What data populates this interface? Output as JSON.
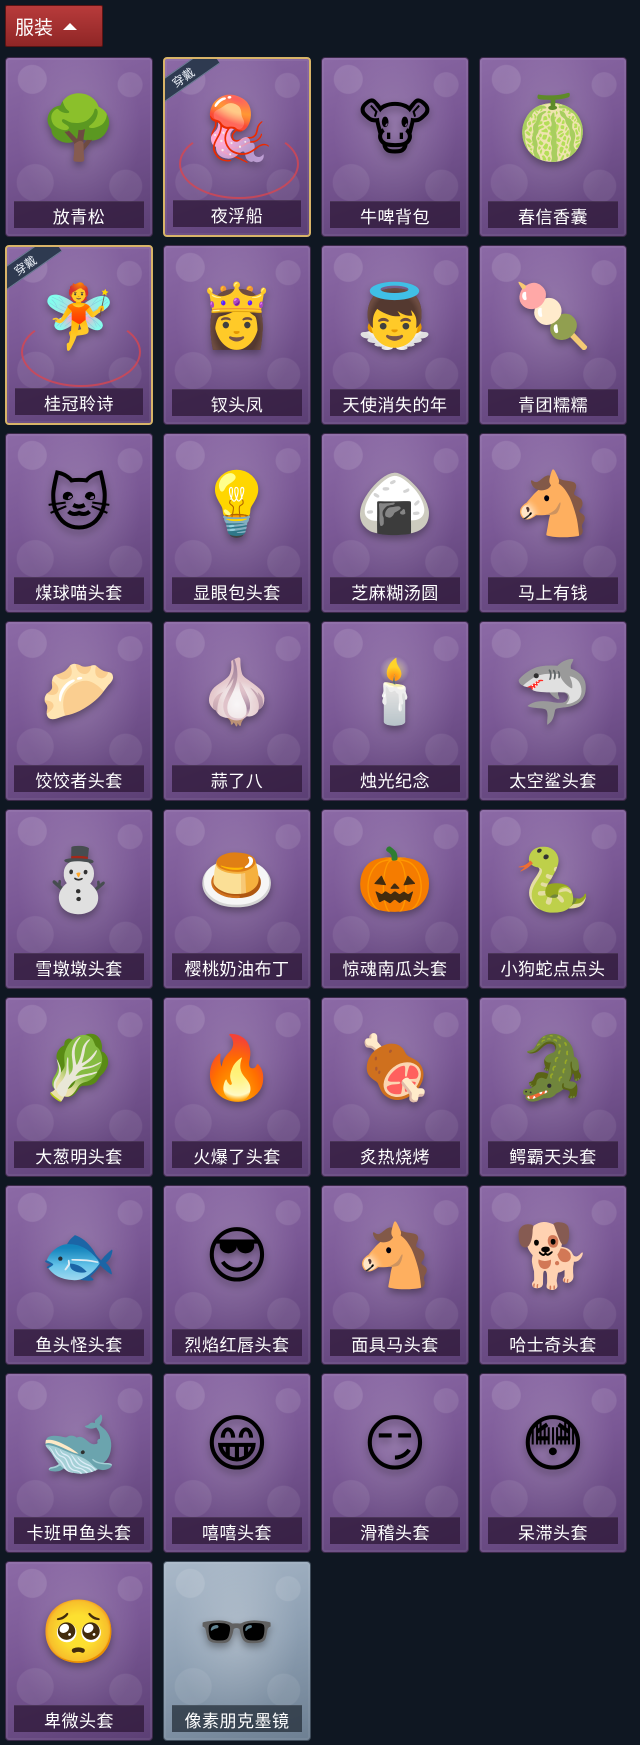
{
  "section": {
    "title": "服装"
  },
  "badge_label": "穿戴",
  "items": [
    {
      "name": "放青松",
      "icon": "🌳",
      "equipped": false,
      "pale": false
    },
    {
      "name": "夜浮船",
      "icon": "🪼",
      "equipped": true,
      "pale": false
    },
    {
      "name": "牛啤背包",
      "icon": "🐮",
      "equipped": false,
      "pale": false
    },
    {
      "name": "春信香囊",
      "icon": "🍈",
      "equipped": false,
      "pale": false
    },
    {
      "name": "桂冠聆诗",
      "icon": "🧚",
      "equipped": true,
      "pale": false
    },
    {
      "name": "钗头凤",
      "icon": "👸",
      "equipped": false,
      "pale": false
    },
    {
      "name": "天使消失的年",
      "icon": "👼",
      "equipped": false,
      "pale": false
    },
    {
      "name": "青团糯糯",
      "icon": "🍡",
      "equipped": false,
      "pale": false
    },
    {
      "name": "煤球喵头套",
      "icon": "🐱",
      "equipped": false,
      "pale": false
    },
    {
      "name": "显眼包头套",
      "icon": "💡",
      "equipped": false,
      "pale": false
    },
    {
      "name": "芝麻糊汤圆",
      "icon": "🍙",
      "equipped": false,
      "pale": false
    },
    {
      "name": "马上有钱",
      "icon": "🐴",
      "equipped": false,
      "pale": false
    },
    {
      "name": "饺饺者头套",
      "icon": "🥟",
      "equipped": false,
      "pale": false
    },
    {
      "name": "蒜了八",
      "icon": "🧄",
      "equipped": false,
      "pale": false
    },
    {
      "name": "烛光纪念",
      "icon": "🕯️",
      "equipped": false,
      "pale": false
    },
    {
      "name": "太空鲨头套",
      "icon": "🦈",
      "equipped": false,
      "pale": false
    },
    {
      "name": "雪墩墩头套",
      "icon": "⛄",
      "equipped": false,
      "pale": false
    },
    {
      "name": "樱桃奶油布丁",
      "icon": "🍮",
      "equipped": false,
      "pale": false
    },
    {
      "name": "惊魂南瓜头套",
      "icon": "🎃",
      "equipped": false,
      "pale": false
    },
    {
      "name": "小狗蛇点点头",
      "icon": "🐍",
      "equipped": false,
      "pale": false
    },
    {
      "name": "大葱明头套",
      "icon": "🥬",
      "equipped": false,
      "pale": false
    },
    {
      "name": "火爆了头套",
      "icon": "🔥",
      "equipped": false,
      "pale": false
    },
    {
      "name": "炙热烧烤",
      "icon": "🍖",
      "equipped": false,
      "pale": false
    },
    {
      "name": "鳄霸天头套",
      "icon": "🐊",
      "equipped": false,
      "pale": false
    },
    {
      "name": "鱼头怪头套",
      "icon": "🐟",
      "equipped": false,
      "pale": false
    },
    {
      "name": "烈焰红唇头套",
      "icon": "😎",
      "equipped": false,
      "pale": false
    },
    {
      "name": "面具马头套",
      "icon": "🐴",
      "equipped": false,
      "pale": false
    },
    {
      "name": "哈士奇头套",
      "icon": "🐕",
      "equipped": false,
      "pale": false
    },
    {
      "name": "卡班甲鱼头套",
      "icon": "🐋",
      "equipped": false,
      "pale": false
    },
    {
      "name": "嘻嘻头套",
      "icon": "😁",
      "equipped": false,
      "pale": false
    },
    {
      "name": "滑稽头套",
      "icon": "😏",
      "equipped": false,
      "pale": false
    },
    {
      "name": "呆滞头套",
      "icon": "😳",
      "equipped": false,
      "pale": false
    },
    {
      "name": "卑微头套",
      "icon": "🥺",
      "equipped": false,
      "pale": false
    },
    {
      "name": "像素朋克墨镜",
      "icon": "🕶️",
      "equipped": false,
      "pale": true
    }
  ]
}
